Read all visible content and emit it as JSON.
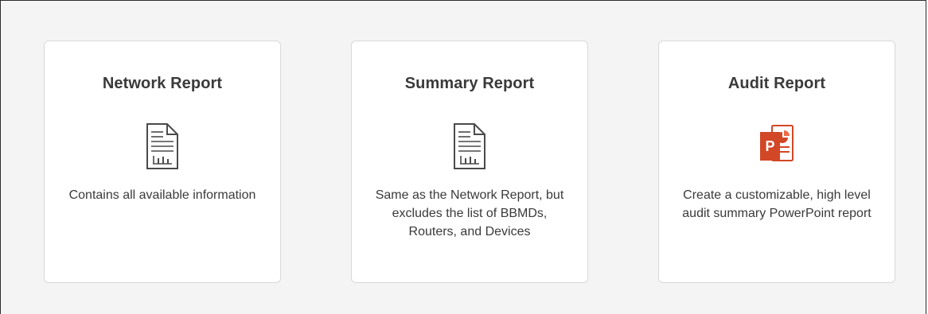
{
  "cards": [
    {
      "title": "Network Report",
      "description": "Contains all available information",
      "icon": "document-chart-icon"
    },
    {
      "title": "Summary Report",
      "description": "Same as the Network Report, but excludes the list of BBMDs, Routers, and Devices",
      "icon": "document-chart-icon"
    },
    {
      "title": "Audit Report",
      "description": "Create a customizable, high level audit summary PowerPoint report",
      "icon": "powerpoint-icon",
      "icon_letter": "P",
      "accent_color": "#d24726"
    }
  ]
}
